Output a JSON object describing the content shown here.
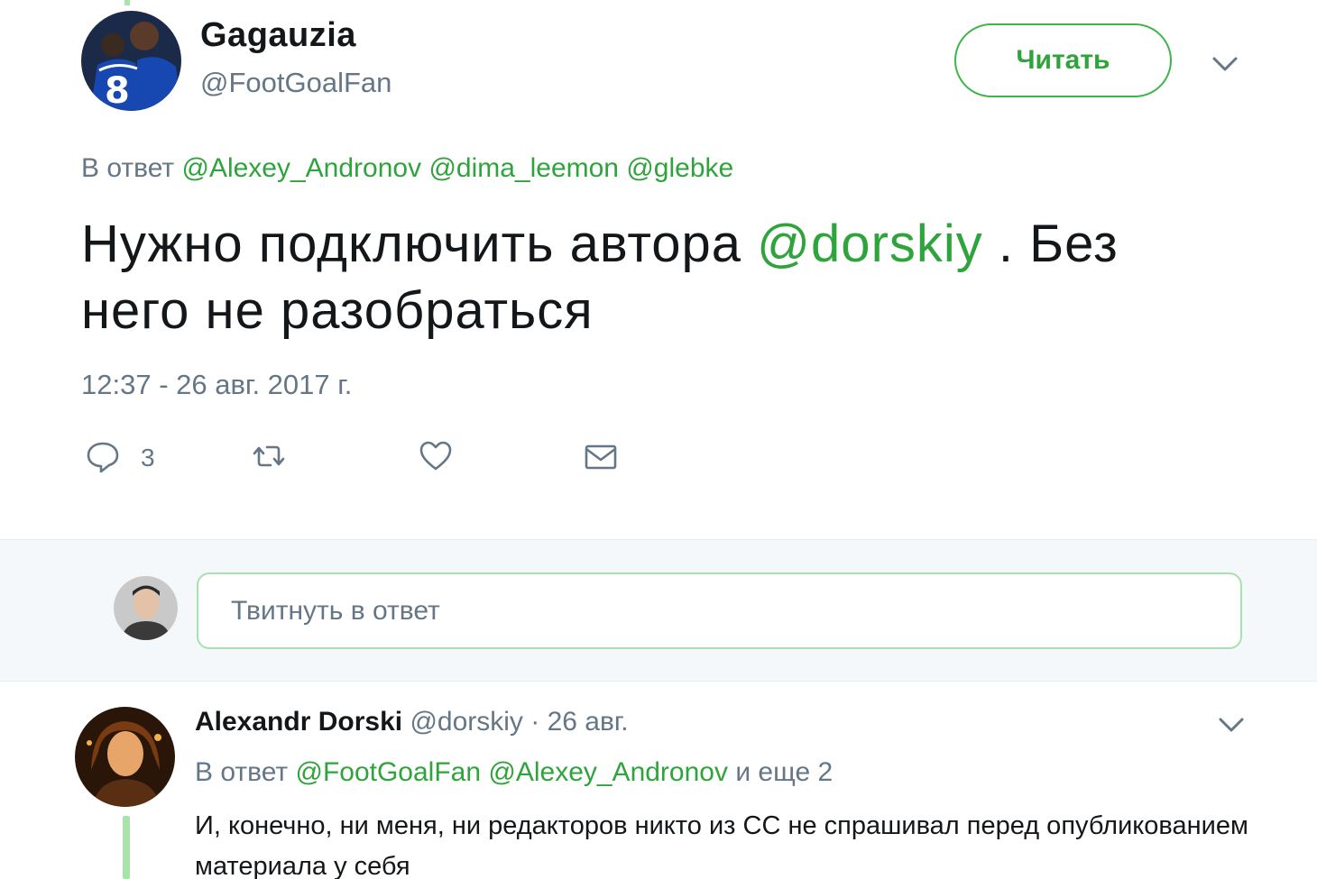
{
  "tweet": {
    "author_name": "Gagauzia",
    "author_handle": "@FootGoalFan",
    "follow_label": "Читать",
    "reply_to_prefix": "В ответ",
    "reply_to_mentions": [
      "@Alexey_Andronov",
      "@dima_leemon",
      "@glebke"
    ],
    "text_part1": "Нужно подключить автора ",
    "text_mention": "@dorskiy",
    "text_part2": " . Без него не разобраться",
    "timestamp": "12:37 - 26 авг. 2017 г.",
    "reply_count": "3",
    "accent_color": "#2fa33c"
  },
  "reply_box": {
    "placeholder": "Твитнуть в ответ"
  },
  "reply": {
    "author_name": "Alexandr Dorski",
    "author_handle": "@dorskiy",
    "date": "· 26 авг.",
    "reply_to_prefix": "В ответ",
    "reply_to_mentions": [
      "@FootGoalFan",
      "@Alexey_Andronov"
    ],
    "reply_to_more": "и еще 2",
    "text": "И, конечно, ни меня, ни редакторов никто из СС не спрашивал перед опубликованием материала у себя"
  },
  "icons": [
    "reply-icon",
    "retweet-icon",
    "like-icon",
    "message-icon",
    "chevron-down-icon"
  ]
}
